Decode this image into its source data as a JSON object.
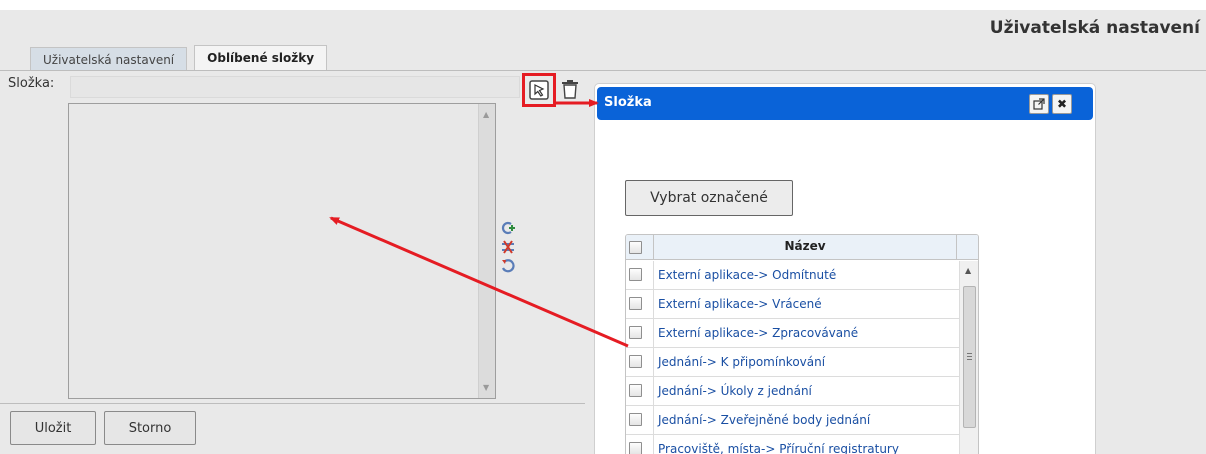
{
  "page": {
    "title": "Uživatelská nastavení"
  },
  "tabs": [
    {
      "label": "Uživatelská nastavení",
      "active": false
    },
    {
      "label": "Oblíbené složky",
      "active": true
    }
  ],
  "form": {
    "folder_label": "Složka:",
    "folder_value": "",
    "pick_icon": "select-folder-icon",
    "delete_icon": "trash-icon"
  },
  "side_icons": [
    "add-link-icon",
    "remove-link-icon",
    "refresh-icon"
  ],
  "buttons": {
    "save": "Uložit",
    "cancel": "Storno"
  },
  "dialog": {
    "title": "Složka",
    "maximize_icon": "popout-icon",
    "close_icon": "close-icon",
    "select_button": "Vybrat označené",
    "grid": {
      "column": "Název",
      "rows": [
        "Externí aplikace-> Odmítnuté",
        "Externí aplikace-> Vrácené",
        "Externí aplikace-> Zpracovávané",
        "Jednání-> K připomínkování",
        "Jednání-> Úkoly z jednání",
        "Jednání-> Zveřejněné body jednání",
        "Pracoviště, místa-> Příruční registratury"
      ]
    }
  },
  "colors": {
    "dialog_header": "#0a63d8",
    "annotation": "#e51c23",
    "link_text": "#1a4fa3"
  }
}
